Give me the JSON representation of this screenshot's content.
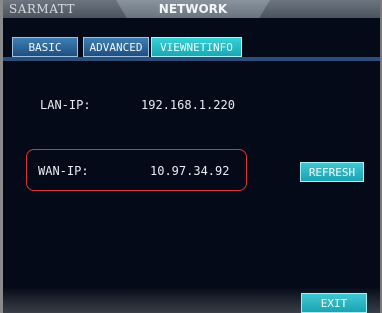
{
  "header": {
    "brand": "SARMATT",
    "title": "NETWORK"
  },
  "tabs": [
    {
      "label": "BASIC",
      "active": false
    },
    {
      "label": "ADVANCED",
      "active": false
    },
    {
      "label": "VIEWNETINFO",
      "active": true
    }
  ],
  "network_info": {
    "lan_label": "LAN-IP:",
    "lan_value": "192.168.1.220",
    "wan_label": "WAN-IP:",
    "wan_value": "10.97.34.92"
  },
  "buttons": {
    "refresh": "REFRESH",
    "exit": "EXIT"
  },
  "colors": {
    "background": "#040a18",
    "tab_blue": "#2f6599",
    "tab_active_cyan": "#24bcc5",
    "highlight_red": "#e13131"
  }
}
